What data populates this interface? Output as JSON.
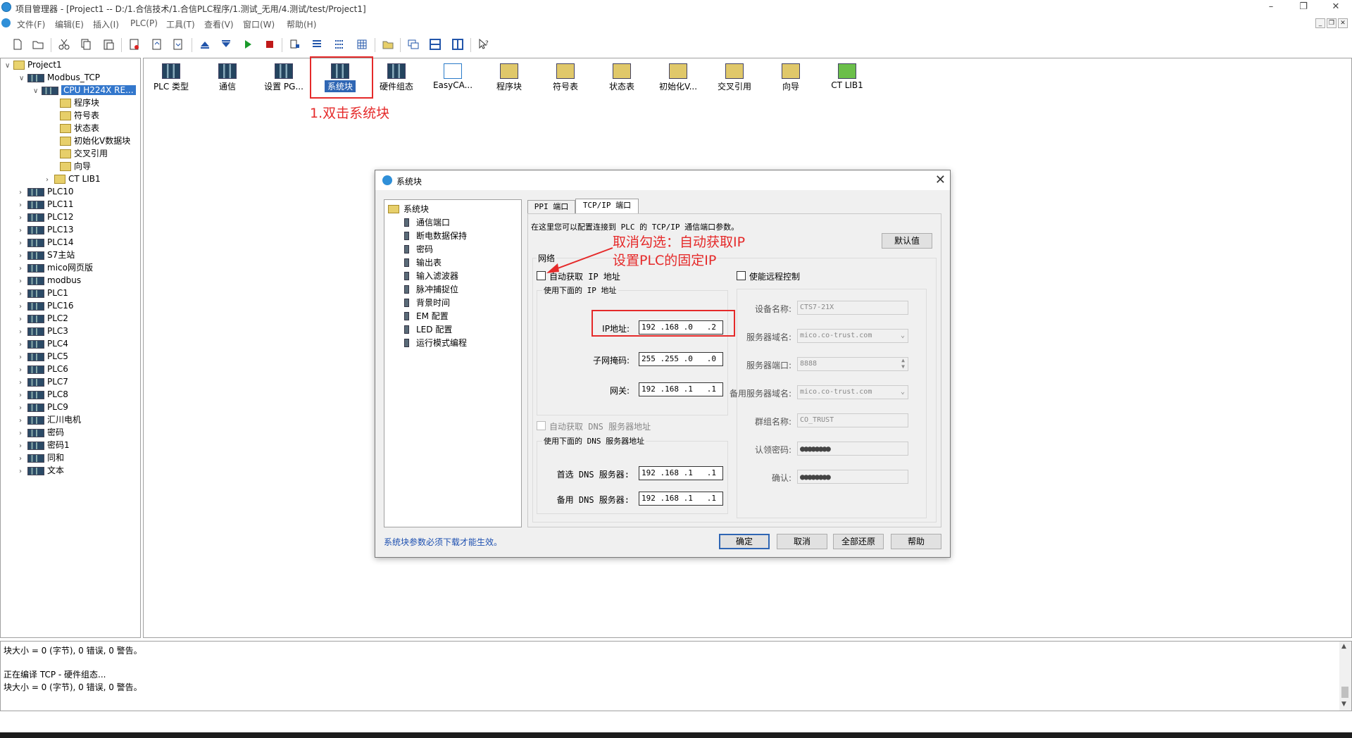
{
  "window": {
    "title": "项目管理器 - [Project1 -- D:/1.合信技术/1.合信PLC程序/1.测试_无用/4.测试/test/Project1]",
    "min_label": "–",
    "max_label": "❐",
    "close_label": "✕"
  },
  "menu": [
    "文件(F)",
    "编辑(E)",
    "插入(I)",
    "PLC(P)",
    "工具(T)",
    "查看(V)",
    "窗口(W)",
    "帮助(H)"
  ],
  "tree": {
    "root": "Project1",
    "project": "Modbus_TCP",
    "cpu": "CPU H224X RE...",
    "cpu_children": [
      "程序块",
      "符号表",
      "状态表",
      "初始化V数据块",
      "交叉引用",
      "向导",
      "CT LIB1"
    ],
    "others": [
      "PLC10",
      "PLC11",
      "PLC12",
      "PLC13",
      "PLC14",
      "S7主站",
      "mico网页版",
      "modbus",
      "PLC1",
      "PLC16",
      "PLC2",
      "PLC3",
      "PLC4",
      "PLC5",
      "PLC6",
      "PLC7",
      "PLC8",
      "PLC9",
      "汇川电机",
      "密码",
      "密码1",
      "同和",
      "文本"
    ]
  },
  "nav": [
    "PLC 类型",
    "通信",
    "设置 PG...",
    "系统块",
    "硬件组态",
    "EasyCA...",
    "程序块",
    "符号表",
    "状态表",
    "初始化V...",
    "交叉引用",
    "向导",
    "CT LIB1"
  ],
  "annotations": {
    "step1": "1.双击系统块",
    "step2_line1": "取消勾选：自动获取IP",
    "step2_line2": "设置PLC的固定IP"
  },
  "dialog": {
    "title": "系统块",
    "close": "✕",
    "tree_root": "系统块",
    "tree_items": [
      "通信端口",
      "断电数据保持",
      "密码",
      "输出表",
      "输入滤波器",
      "脉冲捕捉位",
      "背景时间",
      "EM 配置",
      "LED 配置",
      "运行模式编程"
    ],
    "tabs": [
      "PPI 端口",
      "TCP/IP 端口"
    ],
    "description": "在这里您可以配置连接到 PLC 的 TCP/IP 通信端口参数。",
    "default_button": "默认值",
    "network_label": "网络",
    "auto_ip_label": "自动获取 IP 地址",
    "use_ip_group": "使用下面的 IP 地址",
    "ip_label": "IP地址:",
    "ip_value": "192 .168 .0   .2",
    "subnet_label": "子网掩码:",
    "subnet_value": "255 .255 .0   .0",
    "gateway_label": "网关:",
    "gateway_value": "192 .168 .1   .1",
    "auto_dns_label": "自动获取 DNS 服务器地址",
    "use_dns_group": "使用下面的 DNS 服务器地址",
    "dns1_label": "首选 DNS 服务器:",
    "dns1_value": "192 .168 .1   .1",
    "dns2_label": "备用 DNS 服务器:",
    "dns2_value": "192 .168 .1   .1",
    "remote_label": "使能远程控制",
    "device_name_label": "设备名称:",
    "device_name_value": "CTS7-21X",
    "server_domain_label": "服务器域名:",
    "server_domain_value": "mico.co-trust.com",
    "server_port_label": "服务器端口:",
    "server_port_value": "8888",
    "backup_domain_label": "备用服务器域名:",
    "backup_domain_value": "mico.co-trust.com",
    "group_name_label": "群组名称:",
    "group_name_value": "CO_TRUST",
    "auth_pwd_label": "认领密码:",
    "auth_pwd_value": "●●●●●●●●",
    "confirm_label": "确认:",
    "confirm_value": "●●●●●●●●",
    "footer_note": "系统块参数必须下载才能生效。",
    "ok": "确定",
    "cancel": "取消",
    "restore_all": "全部还原",
    "help": "帮助"
  },
  "output": {
    "line1": "块大小 = 0 (字节),  0 错误,  0 警告。",
    "line2": "正在编译 TCP - 硬件组态...",
    "line3": "块大小 = 0 (字节),  0 错误,  0 警告。"
  },
  "colors": {
    "accent": "#2f66b4",
    "annotation": "#e52a2a"
  }
}
